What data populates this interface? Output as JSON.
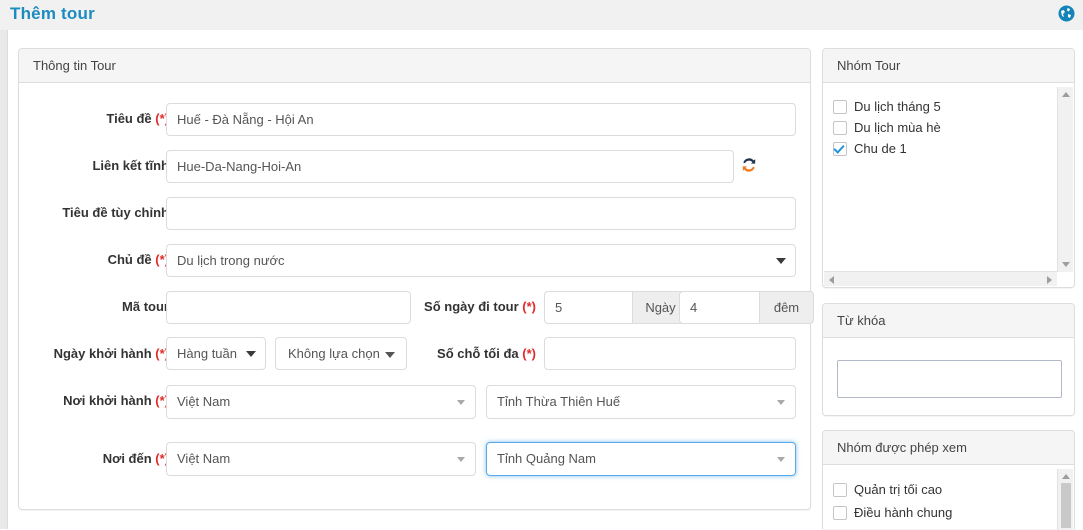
{
  "header": {
    "title": "Thêm tour",
    "globe_icon": "globe-icon",
    "accent_color": "#1c8bc0"
  },
  "main_panel": {
    "title": "Thông tin Tour",
    "fields": {
      "title": {
        "label": "Tiêu đề",
        "required": "(*)",
        "value": "Huế - Đà Nẵng - Hội An"
      },
      "slug": {
        "label": "Liên kết tĩnh",
        "required": "",
        "value": "Hue-Da-Nang-Hoi-An",
        "refresh_icon": "refresh-icon"
      },
      "custom_title": {
        "label": "Tiêu đề tùy chỉnh",
        "required": "",
        "value": ""
      },
      "topic": {
        "label": "Chủ đề",
        "required": "(*)",
        "value": "Du lịch trong nước"
      },
      "tour_code": {
        "label": "Mã tour",
        "required": "",
        "value": ""
      },
      "duration": {
        "label": "Số ngày đi tour",
        "required": "(*)",
        "days_value": "5",
        "days_addon": "Ngày",
        "nights_value": "4",
        "nights_addon": "đêm"
      },
      "departure_date": {
        "label": "Ngày khởi hành",
        "required": "(*)",
        "frequency_value": "Hàng tuần",
        "day_value": "Không lựa chọn"
      },
      "max_slots": {
        "label": "Số chỗ tối đa",
        "required": "(*)",
        "value": ""
      },
      "departure_place": {
        "label": "Nơi khởi hành",
        "required": "(*)",
        "country_value": "Việt Nam",
        "province_value": "Tỉnh Thừa Thiên Huế"
      },
      "destination": {
        "label": "Nơi đến",
        "required": "(*)",
        "country_value": "Việt Nam",
        "province_value": "Tỉnh Quảng Nam",
        "focused": true
      }
    }
  },
  "group_panel": {
    "title": "Nhóm Tour",
    "items": [
      {
        "label": "Du lịch tháng 5",
        "checked": false
      },
      {
        "label": "Du lịch mùa hè",
        "checked": false
      },
      {
        "label": "Chu de 1",
        "checked": true
      }
    ]
  },
  "keyword_panel": {
    "title": "Từ khóa",
    "value": "",
    "placeholder": ""
  },
  "view_group_panel": {
    "title": "Nhóm được phép xem",
    "items": [
      {
        "label": "Quản trị tối cao",
        "checked": false
      },
      {
        "label": "Điều hành chung",
        "checked": false
      }
    ]
  }
}
